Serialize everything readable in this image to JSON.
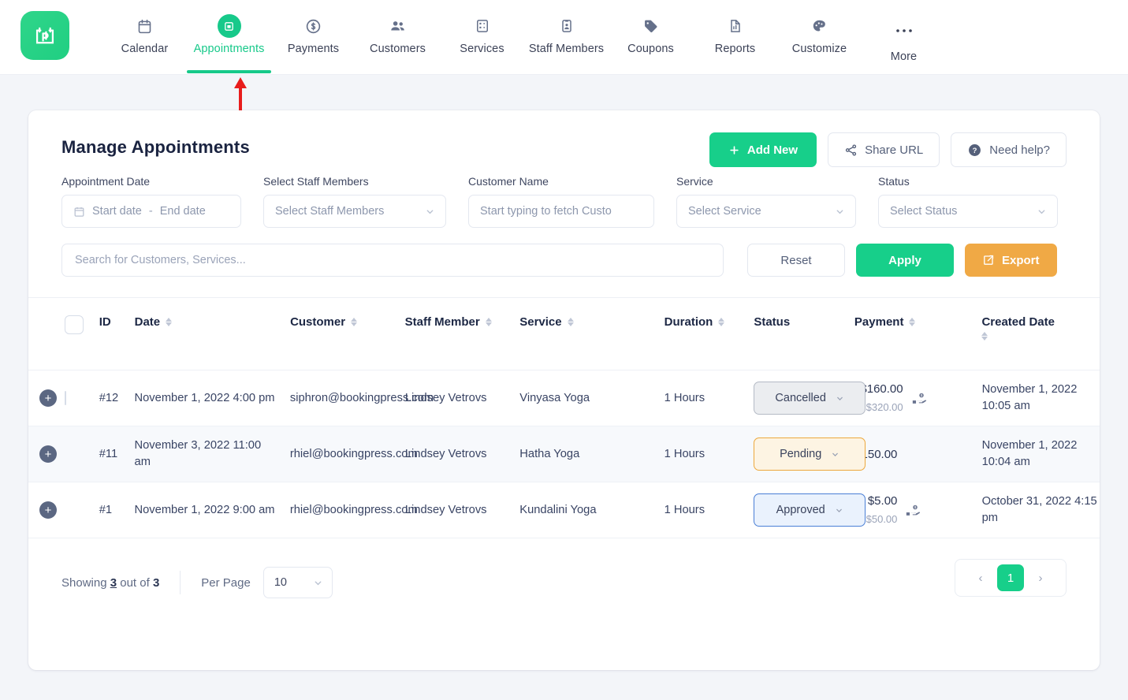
{
  "nav": {
    "logo_name": "bookingpress-logo",
    "items": [
      {
        "label": "Calendar",
        "icon": "calendar-icon",
        "active": false
      },
      {
        "label": "Appointments",
        "icon": "appointments-icon",
        "active": true
      },
      {
        "label": "Payments",
        "icon": "payments-icon",
        "active": false
      },
      {
        "label": "Customers",
        "icon": "customers-icon",
        "active": false
      },
      {
        "label": "Services",
        "icon": "services-icon",
        "active": false
      },
      {
        "label": "Staff Members",
        "icon": "staff-members-icon",
        "active": false
      },
      {
        "label": "Coupons",
        "icon": "coupons-icon",
        "active": false
      },
      {
        "label": "Reports",
        "icon": "reports-icon",
        "active": false
      },
      {
        "label": "Customize",
        "icon": "customize-icon",
        "active": false
      },
      {
        "label": "More",
        "icon": "more-ellipsis-icon",
        "active": false
      }
    ]
  },
  "annotation": {
    "arrow_color": "#e81c1c",
    "points_to": "Appointments"
  },
  "header": {
    "title": "Manage Appointments",
    "add_new": "Add New",
    "share_url": "Share URL",
    "need_help": "Need help?"
  },
  "filters": {
    "appointment_date": {
      "label": "Appointment Date",
      "start_placeholder": "Start date",
      "separator": "-",
      "end_placeholder": "End date"
    },
    "staff": {
      "label": "Select Staff Members",
      "placeholder": "Select Staff Members"
    },
    "customer": {
      "label": "Customer Name",
      "placeholder": "Start typing to fetch Custo"
    },
    "service": {
      "label": "Service",
      "placeholder": "Select Service"
    },
    "status": {
      "label": "Status",
      "placeholder": "Select Status"
    }
  },
  "search": {
    "placeholder": "Search for Customers, Services...",
    "reset": "Reset",
    "apply": "Apply",
    "export": "Export"
  },
  "table": {
    "columns": [
      {
        "key": "id",
        "label": "ID",
        "sortable": false
      },
      {
        "key": "date",
        "label": "Date",
        "sortable": true
      },
      {
        "key": "customer",
        "label": "Customer",
        "sortable": true
      },
      {
        "key": "staff",
        "label": "Staff Member",
        "sortable": true
      },
      {
        "key": "service",
        "label": "Service",
        "sortable": true
      },
      {
        "key": "duration",
        "label": "Duration",
        "sortable": true
      },
      {
        "key": "status",
        "label": "Status",
        "sortable": false
      },
      {
        "key": "payment",
        "label": "Payment",
        "sortable": true
      },
      {
        "key": "created",
        "label": "Created Date",
        "sortable": true
      }
    ],
    "rows": [
      {
        "id": "#12",
        "date": "November 1, 2022 4:00 pm",
        "customer": "siphron@bookingpress.com",
        "staff": "Lindsey Vetrovs",
        "service": "Vinyasa Yoga",
        "duration": "1 Hours",
        "status": "Cancelled",
        "status_variant": "cancelled",
        "payment_paid": "$160.00",
        "payment_total": "of $320.00",
        "has_payment_icon": true,
        "has_checkbox": true,
        "created": "November 1, 2022 10:05 am"
      },
      {
        "id": "#11",
        "date": "November 3, 2022 11:00 am",
        "customer": "rhiel@bookingpress.com",
        "staff": "Lindsey Vetrovs",
        "service": "Hatha Yoga",
        "duration": "1 Hours",
        "status": "Pending",
        "status_variant": "pending",
        "payment_paid": "$150.00",
        "payment_total": "",
        "has_payment_icon": false,
        "has_checkbox": false,
        "created": "November 1, 2022 10:04 am"
      },
      {
        "id": "#1",
        "date": "November 1, 2022 9:00 am",
        "customer": "rhiel@bookingpress.com",
        "staff": "Lindsey Vetrovs",
        "service": "Kundalini Yoga",
        "duration": "1 Hours",
        "status": "Approved",
        "status_variant": "approved",
        "payment_paid": "$5.00",
        "payment_total": "of $50.00",
        "has_payment_icon": true,
        "has_checkbox": false,
        "created": "October 31, 2022 4:15 pm"
      }
    ]
  },
  "footer": {
    "showing_prefix": "Showing",
    "showing_count": "3",
    "showing_mid": "out of",
    "showing_total": "3",
    "per_page_label": "Per Page",
    "per_page_value": "10",
    "prev": "‹",
    "next": "›",
    "current_page": "1"
  },
  "colors": {
    "brand_green": "#17cf8a",
    "export_orange": "#f0a945",
    "status_cancelled_border": "#b4bac5",
    "status_pending_border": "#eda83c",
    "status_approved_border": "#4a7fd6",
    "annotation_red": "#e81c1c"
  }
}
